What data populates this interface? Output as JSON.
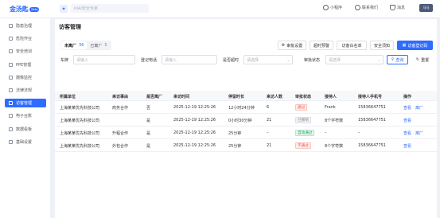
{
  "header": {
    "logo": "金汤匙",
    "logo_badge": "Beta",
    "search_placeholder": "问AI安全专家",
    "mini_program": "小程序",
    "contact": "联系我们",
    "messages": "消息",
    "avatar": "马马"
  },
  "sidebar": {
    "items": [
      {
        "label": "隐患治理",
        "icon": "shield-icon"
      },
      {
        "label": "危险作业",
        "icon": "warning-icon"
      },
      {
        "label": "安全培训",
        "icon": "book-icon"
      },
      {
        "label": "PPE管理",
        "icon": "helmet-icon"
      },
      {
        "label": "摄像监控",
        "icon": "camera-icon"
      },
      {
        "label": "法律法规",
        "icon": "scale-icon"
      },
      {
        "label": "访客管理",
        "icon": "visitor-icon"
      },
      {
        "label": "电子台账",
        "icon": "ledger-icon"
      },
      {
        "label": "数据看板",
        "icon": "dashboard-icon"
      },
      {
        "label": "基础设置",
        "icon": "settings-icon"
      }
    ],
    "active_index": 6
  },
  "page": {
    "title": "访客管理",
    "tabs": [
      {
        "label": "未离厂",
        "count": "36"
      },
      {
        "label": "已离厂",
        "count": "5"
      }
    ],
    "buttons": {
      "approval": "审批设置",
      "timeout": "超时预警",
      "whitelist": "访客白名单",
      "notice": "安全须知",
      "register_code": "访客登记码"
    },
    "filters": {
      "plate_label": "车牌",
      "plate_placeholder": "请输入",
      "phone_label": "登记电话",
      "phone_placeholder": "请输入",
      "timeout_label": "是否超时",
      "timeout_placeholder": "请选择",
      "status_label": "审批状态",
      "status_placeholder": "请选择",
      "query": "查询",
      "reset": "重置"
    },
    "table": {
      "headers": [
        "所属单位",
        "来访事由",
        "是否离厂",
        "来访时间",
        "停留时长",
        "来访人数",
        "审批状态",
        "接待人",
        "接待人手机号",
        "操作"
      ],
      "rows": [
        {
          "unit": "上海某某优先科技公司",
          "reason": "商务合作",
          "left": "否",
          "time": "2025-12-19 12:25:26",
          "duration": "12小时24分钟",
          "count": "6",
          "status": "通过",
          "status_style": "red",
          "host": "Frank",
          "phone": "15836647751",
          "view": "查看",
          "leave": "离厂"
        },
        {
          "unit": "上海某某优先科技公司",
          "reason": "",
          "left": "是",
          "time": "2025-12-19 12:25:26",
          "duration": "0小时30分钟",
          "count": "21",
          "status": "已撤销",
          "status_style": "grey",
          "host": "8个字符数",
          "phone": "15836647751",
          "view": "查看",
          "leave": ""
        },
        {
          "unit": "上海某某优先科技公司",
          "reason": "升程合作",
          "left": "是",
          "time": "2025-12-19 12:25:26",
          "duration": "25分钟",
          "count": "–",
          "status": "自动通过",
          "status_style": "green",
          "host": "–",
          "phone": "–",
          "view": "查看",
          "leave": "离厂"
        },
        {
          "unit": "上海某某优先科技公司",
          "reason": "外包合作",
          "left": "是",
          "time": "2025-12-19 12:25:26",
          "duration": "25分钟",
          "count": "21",
          "status": "不通过",
          "status_style": "red",
          "host": "8个字符数",
          "phone": "15836647751",
          "view": "查看",
          "leave": ""
        }
      ]
    }
  },
  "colors": {
    "primary": "#2f6bff",
    "danger": "#e8594c",
    "success": "#1fa463",
    "muted": "#888888"
  }
}
